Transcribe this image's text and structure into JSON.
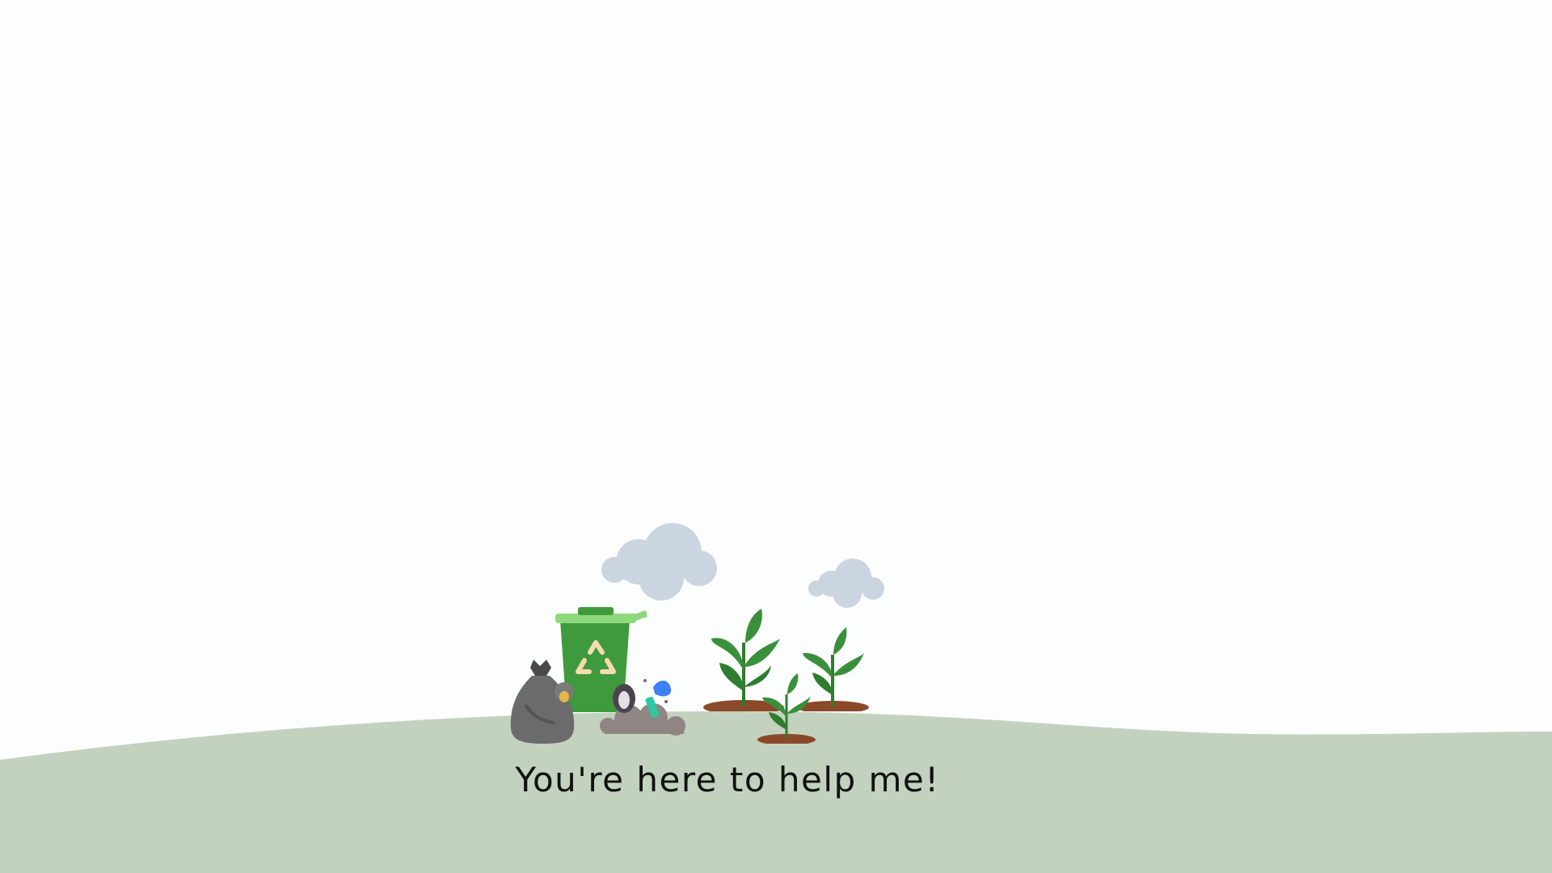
{
  "scene": {
    "caption": "You're here to help me!",
    "colors": {
      "sky": "#fcfdfd",
      "ground": "#c3d2bf",
      "cloud": "#cbd5e1",
      "bin": "#3f9a3d",
      "bin_lid": "#8fd87c",
      "recycle_symbol": "#f6dbb0",
      "trash_bag": "#6b6b6b",
      "trash_pile": "#8f8582",
      "leaf": "#3a8f3a",
      "soil": "#8a4a2a"
    },
    "icons": {
      "clouds": "cloud-icon",
      "bin": "recycling-bin-icon",
      "bag": "trash-bag-icon",
      "pile": "trash-pile-icon",
      "plants": "sprout-icon"
    }
  }
}
